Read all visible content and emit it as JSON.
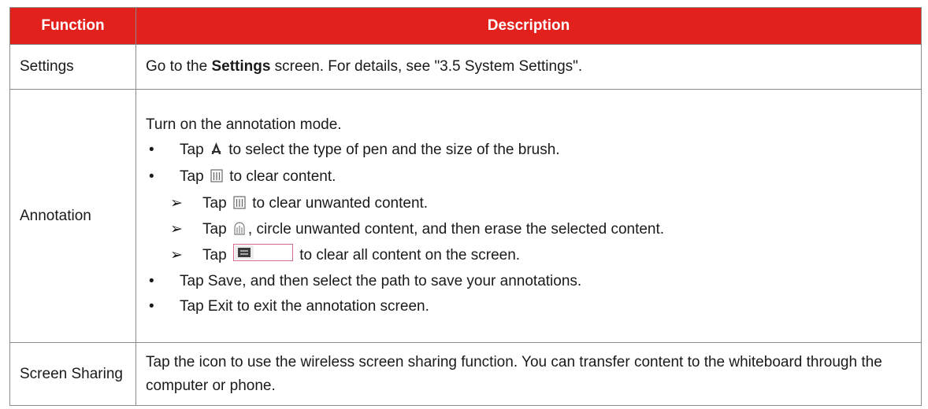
{
  "page_caption": "",
  "colors": {
    "header_bg": "#e3211c",
    "header_text": "#ffffff",
    "border": "#8a8a8a"
  },
  "table": {
    "headers": {
      "function": "Function",
      "description": "Description"
    },
    "settings": {
      "function": "Settings",
      "desc_pre": "Go to the ",
      "desc_bold": "Settings",
      "desc_post": " screen. For details, see \"3.5 System Settings\"."
    },
    "annotation": {
      "function": "Annotation",
      "intro": "Turn on the annotation mode.",
      "bullet_pen": {
        "pre": "Tap ",
        "icon": "pen-icon",
        "post": " to select the type of pen and the size of the brush."
      },
      "bullet_eraser": {
        "pre": "Tap ",
        "icon": "eraser-icon",
        "post": " to clear content."
      },
      "sub_eraser": {
        "pre": "Tap ",
        "icon": "eraser-icon",
        "post": " to clear unwanted content."
      },
      "sub_circle": {
        "pre": "Tap ",
        "icon": "circle-eraser-icon",
        "post": ", circle unwanted content, and then erase the selected content."
      },
      "sub_clear_all": {
        "pre": "Tap ",
        "icon": "clear-all-slider-icon",
        "post": " to clear all content on the screen."
      },
      "bullet_save": "Tap Save, and then select the path to save your annotations.",
      "bullet_exit": "Tap Exit to exit the annotation screen."
    },
    "sharing": {
      "function": "Screen Sharing",
      "desc": "Tap the icon to use the wireless screen sharing function. You can transfer content to the whiteboard through the computer or phone."
    }
  },
  "glyphs": {
    "bullet": "•",
    "arrow": "➢"
  }
}
